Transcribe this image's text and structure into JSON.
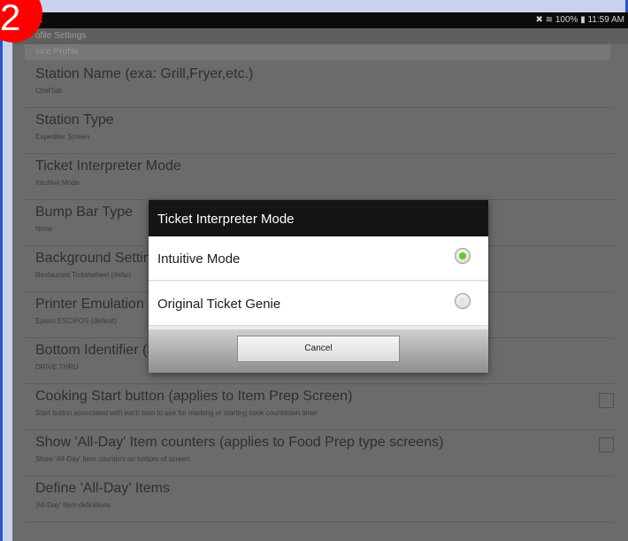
{
  "status_bar": {
    "left": "...",
    "right": "✖ ≋ 100% ▮ 11:59 AM"
  },
  "app_bar": {
    "title": "ofile Settings"
  },
  "section_header": "vice Profile",
  "settings": [
    {
      "title": "Station Name (exa: Grill,Fryer,etc.)",
      "subtitle": "ChefTab"
    },
    {
      "title": "Station Type",
      "subtitle": "Expediter Screen"
    },
    {
      "title": "Ticket Interpreter Mode",
      "subtitle": "Intuitive Mode"
    },
    {
      "title": "Bump Bar Type",
      "subtitle": "None"
    },
    {
      "title": "Background Setting",
      "subtitle": "Restaurant Ticketwheel (defau"
    },
    {
      "title": "Printer Emulation",
      "subtitle": "Epson ESC/POS (default)"
    },
    {
      "title": "Bottom Identifier (S",
      "subtitle": "DRIVE THRU"
    },
    {
      "title": "Cooking Start button (applies to Item Prep Screen)",
      "subtitle": "Start button associated with each item to use for marking or starting cook countdown timer",
      "checked": false
    },
    {
      "title": "Show 'All-Day' Item counters (applies to Food Prep type screens)",
      "subtitle": "Show 'All-Day' Item counters on bottom of screen",
      "checked": false
    },
    {
      "title": "Define 'All-Day' Items",
      "subtitle": "'All-Day' Item definitions"
    }
  ],
  "dialog": {
    "title": "Ticket Interpreter Mode",
    "options": [
      {
        "label": "Intuitive Mode",
        "selected": true
      },
      {
        "label": "Original Ticket Genie",
        "selected": false
      }
    ],
    "cancel_label": "Cancel"
  },
  "badge": "2",
  "colors": {
    "frame_border": "#2a54c9",
    "badge": "#ff0000",
    "radio_selected": "#5ecb2a"
  }
}
